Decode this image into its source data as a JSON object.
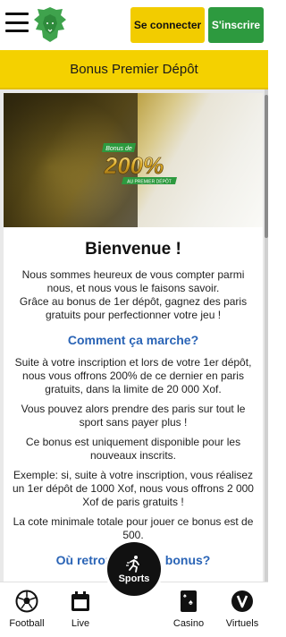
{
  "header": {
    "login_label": "Se connecter",
    "signup_label": "S'inscrire"
  },
  "bonus_bar": {
    "title": "Bonus Premier Dépôt"
  },
  "banner": {
    "badge_top": "Bonus de",
    "badge_value": "200%",
    "badge_bottom": "AU PREMIER DÉPÔT"
  },
  "article": {
    "title": "Bienvenue !",
    "intro_1": "Nous sommes heureux de vous compter parmi nous, et nous vous le faisons savoir.",
    "intro_2": "Grâce au bonus de 1er dépôt, gagnez des paris gratuits pour perfectionner votre jeu !",
    "how_title": "Comment ça marche?",
    "how_p1": "Suite à votre inscription et lors de votre 1er dépôt, nous vous offrons 200% de ce dernier en paris gratuits, dans la limite de 20 000 Xof.",
    "how_p2": "Vous pouvez alors prendre des paris sur tout le sport sans payer plus !",
    "how_p3": "Ce bonus est uniquement disponible pour les nouveaux inscrits.",
    "how_p4": "Exemple: si, suite à votre inscription, vous réalisez un 1er dépôt de 1000 Xof, nous vous offrons 2 000 Xof de paris gratuits !",
    "how_p5": "La cote minimale totale pour jouer ce bonus est de 500.",
    "where_title": "Où retrouver mon bonus?"
  },
  "bottom_nav": {
    "football": "Football",
    "live": "Live",
    "sports": "Sports",
    "casino": "Casino",
    "virtuels": "Virtuels"
  },
  "colors": {
    "brand_yellow": "#f2cc00",
    "brand_green": "#2d9a3f",
    "link_blue": "#2a64b6"
  }
}
